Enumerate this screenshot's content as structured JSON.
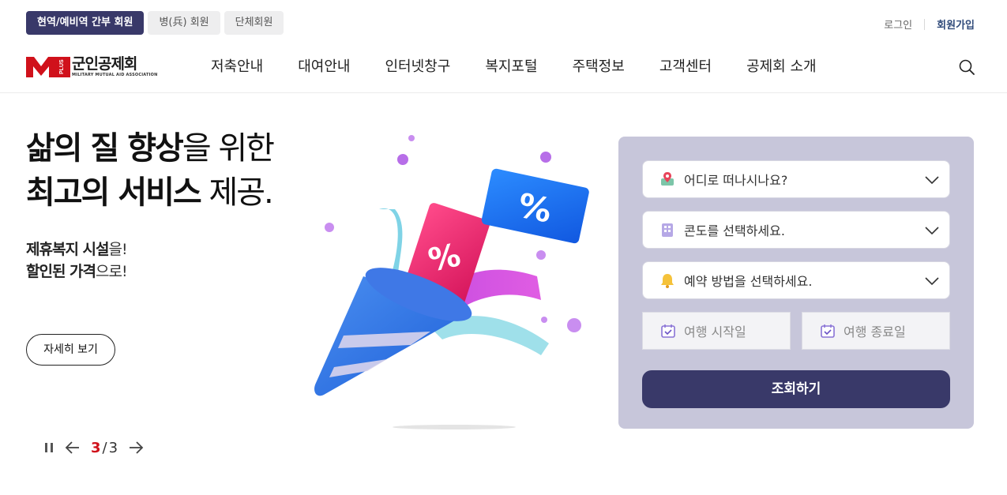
{
  "top": {
    "member_tabs": [
      "현역/예비역 간부 회원",
      "병(兵) 회원",
      "단체회원"
    ],
    "login": "로그인",
    "join": "회원가입"
  },
  "brand": {
    "name": "군인공제회",
    "sub": "MILITARY MUTUAL AID ASSOCIATION",
    "mark_letters": "M",
    "mark_plus": "PLUS",
    "accent": "#d0111b"
  },
  "nav": [
    "저축안내",
    "대여안내",
    "인터넷창구",
    "복지포털",
    "주택정보",
    "고객센터",
    "공제회 소개"
  ],
  "hero": {
    "line1_bold": "삶의 질 향상",
    "line1_rest": "을 위한",
    "line2_bold": "최고의 서비스",
    "line2_rest": " 제공.",
    "sub1_bold": "제휴복지 시설",
    "sub1_rest": "을!",
    "sub2_bold": "할인된 가격",
    "sub2_rest": "으로!",
    "detail_button": "자세히 보기",
    "slide_current": "3",
    "slide_total": "3",
    "coupon_symbol": "%"
  },
  "booking": {
    "destination_placeholder": "어디로 떠나시나요?",
    "condo_placeholder": "콘도를 선택하세요.",
    "method_placeholder": "예약 방법을 선택하세요.",
    "start_date_placeholder": "여행 시작일",
    "end_date_placeholder": "여행 종료일",
    "submit": "조회하기"
  },
  "colors": {
    "primary": "#393969",
    "panel_bg": "#c7c6da",
    "accent_red": "#d0111b"
  }
}
